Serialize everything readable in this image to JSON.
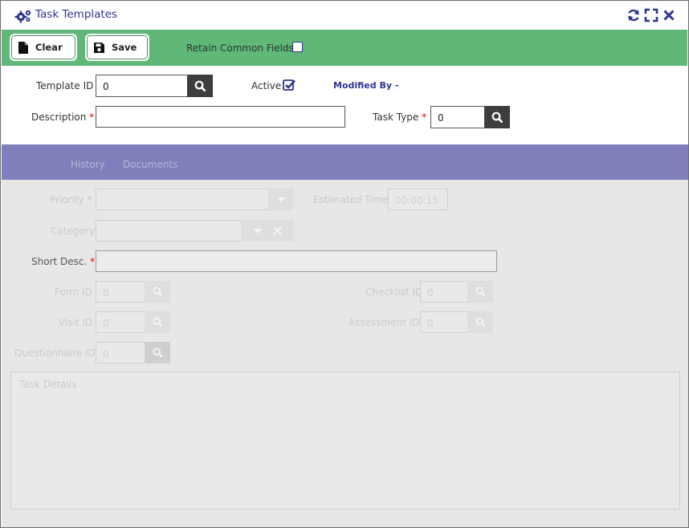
{
  "window": {
    "title": "Task Templates",
    "icons": {
      "title": "gears-icon",
      "refresh": "refresh-icon",
      "expand": "expand-icon",
      "close": "close-icon"
    },
    "accent": "#2e3390"
  },
  "toolbar": {
    "color": "#5fb878",
    "clear_label": "Clear",
    "save_label": "Save",
    "retain_label": "Retain Common Fields",
    "retain_checked": false
  },
  "form": {
    "template_id_label": "Template ID",
    "template_id_value": "0",
    "active_label": "Active",
    "active_checked": true,
    "modified_by_label": "Modified By -",
    "description_label": "Description",
    "description_value": "",
    "task_type_label": "Task Type",
    "task_type_value": "0",
    "required_mark": "*"
  },
  "tabs": {
    "color": "#7f7fbc",
    "items": [
      {
        "label": "History"
      },
      {
        "label": "Documents"
      }
    ]
  },
  "details": {
    "priority_label": "Priority",
    "estimated_time_label": "Estimated Time",
    "estimated_time_value": "00:00:15",
    "category_label": "Category",
    "short_desc_label": "Short Desc.",
    "form_id_label": "Form ID",
    "form_id_value": "0",
    "checklist_id_label": "Checklist ID",
    "checklist_id_value": "0",
    "visit_id_label": "Visit ID",
    "visit_id_value": "0",
    "assessment_id_label": "Assessment ID",
    "assessment_id_value": "0",
    "questionnaire_id_label": "Questionnaire ID",
    "questionnaire_id_value": "0",
    "task_details_label": "Task Details"
  }
}
